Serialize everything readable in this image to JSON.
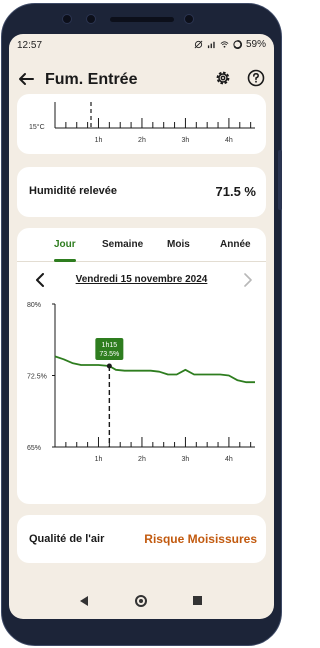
{
  "status_bar": {
    "time": "12:57",
    "battery": "59%"
  },
  "header": {
    "title": "Fum. Entrée"
  },
  "top_chart": {
    "y_label": "15°C",
    "x_ticks": [
      "1h",
      "2h",
      "3h",
      "4h"
    ]
  },
  "humidity": {
    "label": "Humidité relevée",
    "value": "71.5 %"
  },
  "tabs": [
    {
      "label": "Jour",
      "active": true
    },
    {
      "label": "Semaine",
      "active": false
    },
    {
      "label": "Mois",
      "active": false
    },
    {
      "label": "Année",
      "active": false
    }
  ],
  "date_nav": {
    "date": "Vendredi 15 novembre 2024"
  },
  "chart_data": {
    "type": "line",
    "title": "",
    "xlabel": "",
    "ylabel": "",
    "ylim": [
      65,
      80
    ],
    "xlim": [
      0,
      4.6
    ],
    "y_ticks": [
      "80%",
      "72.5%",
      "65%"
    ],
    "y_tick_values": [
      80,
      72.5,
      65
    ],
    "x_ticks": [
      "1h",
      "2h",
      "3h",
      "4h"
    ],
    "x_tick_values": [
      1,
      2,
      3,
      4
    ],
    "color": "#2e7d1f",
    "series": [
      {
        "x": [
          0.0,
          0.2,
          0.4,
          0.6,
          0.8,
          1.0,
          1.25,
          1.4,
          1.6,
          1.8,
          2.0,
          2.2,
          2.4,
          2.6,
          2.8,
          3.0,
          3.2,
          3.4,
          3.6,
          3.8,
          4.0,
          4.2,
          4.4,
          4.6
        ],
        "values": [
          74.5,
          74.2,
          73.8,
          73.6,
          73.6,
          73.6,
          73.5,
          73.1,
          73.0,
          73.0,
          73.0,
          73.0,
          72.9,
          72.6,
          72.6,
          73.1,
          72.6,
          72.6,
          72.6,
          72.6,
          72.5,
          72.0,
          71.8,
          71.8
        ]
      }
    ],
    "tooltip": {
      "time": "1h15",
      "value": "73.5%",
      "x": 1.25,
      "y": 73.5
    }
  },
  "air_quality": {
    "label": "Qualité de l'air",
    "value": "Risque Moisissures"
  },
  "colors": {
    "accent": "#2e7d1f",
    "warning": "#c25a0f",
    "background": "#f3ede4"
  }
}
